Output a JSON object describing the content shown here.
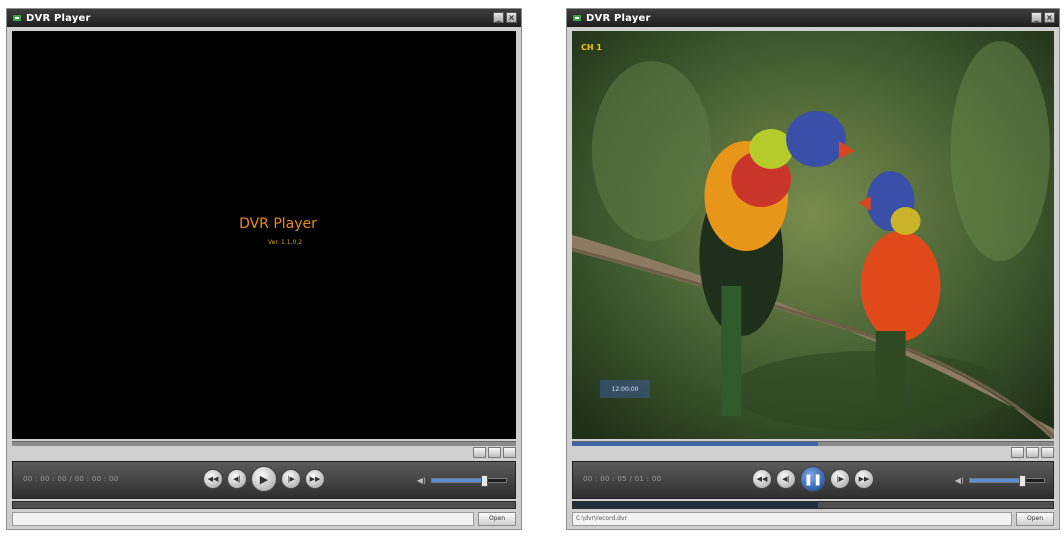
{
  "left_window": {
    "title": "DVR Player",
    "splash_title": "DVR Player",
    "splash_version": "Ver. 1.1.0.2",
    "time_display": "00 : 00 : 00 / 00 : 00 : 00",
    "seek_percent": 0,
    "volume_percent": 70,
    "progress_percent": 0,
    "file_path": "",
    "open_label": "Open",
    "playing": false
  },
  "right_window": {
    "title": "DVR Player",
    "osd_channel": "CH 1",
    "osd_timestamp": "12:00:00",
    "time_display": "00 : 00 : 05 / 01 : 00",
    "seek_percent": 51,
    "volume_percent": 70,
    "progress_percent": 51,
    "file_path": "C:\\dvr\\record.dvr",
    "open_label": "Open",
    "playing": true
  },
  "icons": [
    "app-icon",
    "minimize-icon",
    "close-icon",
    "rewind-icon",
    "step-back-icon",
    "play-icon",
    "pause-icon",
    "step-forward-icon",
    "fast-forward-icon",
    "speaker-icon"
  ],
  "colors": {
    "accent_orange": "#f08a14",
    "seek_blue": "#3d67a6",
    "osd_yellow": "#f4c319"
  }
}
